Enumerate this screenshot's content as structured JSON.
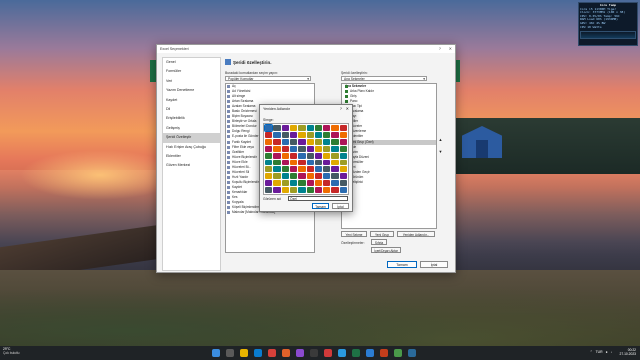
{
  "desktop": {
    "widget": {
      "title": "Core Temp",
      "lines": [
        "Core i5 11300H Tiger",
        "Clock: 3773MHz (100 x 38)",
        "CPU: 0.0%/0%  Temp: 56C",
        "RAM Load 60%  (1934MB)",
        "GPU: 46C  4%  BW",
        "CPU 10 Watts"
      ]
    }
  },
  "excel_options": {
    "title": "Excel Seçenekleri",
    "help": "?",
    "close": "✕",
    "sidebar": [
      {
        "label": "Genel"
      },
      {
        "label": "Formüller"
      },
      {
        "label": "Veri"
      },
      {
        "label": "Yazım Denetleme"
      },
      {
        "label": "Kaydet"
      },
      {
        "label": "Dil"
      },
      {
        "label": "Erişilebilirlik"
      },
      {
        "label": "Gelişmiş"
      },
      {
        "label": "Şeridi Özelleştir"
      },
      {
        "label": "Hızlı Erişim Araç Çubuğu"
      },
      {
        "label": "Eklentiler"
      },
      {
        "label": "Güven Merkezi"
      }
    ],
    "selected_index": 8,
    "header": "Şeridi özelleştirin.",
    "left_label": "Buradaki komutlardan seçim yapın:",
    "left_combo": "Popüler Komutlar",
    "right_label": "Şeridi özelleştirin:",
    "right_combo": "Ana Sekmeler",
    "commands": [
      "Aç",
      "Ad Yöneticisi",
      "Alt simge",
      "Artan Sıralama",
      "Azalan Sıralama",
      "Baskı Önizlemesi",
      "Biçim Boyacısı",
      "Birleştir ve Ortala",
      "Bölmeleri Dondur",
      "Dolgu Rengi",
      "E-posta ile Gönder",
      "Farklı Kaydet",
      "Filtre Ekle veya",
      "Grafikler",
      "Hücre Biçimlendir",
      "Hücre Ekle",
      "Hücreleri Bi...",
      "Hücreleri Sil",
      "Hızlı Yazdır",
      "Koşullu Biçimlendirme",
      "Kaydet",
      "Kenarlıklar",
      "Kes",
      "Kopyala",
      "Köşeli Biçimlendirme",
      "Makrolar [Makroları Görüntüle]"
    ],
    "tree_header": "Ana Sekmeler",
    "tree": [
      "Arka Planı Kaldır",
      "Giriş",
      "Pano",
      "Yazı Tipi",
      "Hizalama",
      "Sayı",
      "Stiller",
      "Hücreler",
      "Düzenleme",
      "Eklentiler",
      "Yeni Grup (Özel)",
      "Ekle",
      "Çizim",
      "Sayfa Düzeni",
      "Formüller",
      "Veri",
      "Gözden Geçir",
      "Görünüm",
      "Geliştirici"
    ],
    "tree_selected_index": 10,
    "new_tab_btn": "Yeni Sekme",
    "new_group_btn": "Yeni Grup",
    "rename_btn": "Yeniden Adlandır...",
    "customizations_label": "Özelleştirmeler:",
    "reset_btn": "Sıfırla",
    "import_export_btn": "İçeri/Dışarı Aktar",
    "add_btn": "»",
    "remove_btn": "«",
    "ok_btn": "Tamam",
    "cancel_btn": "İptal"
  },
  "rename_dialog": {
    "title": "Yeniden Adlandır",
    "help": "?",
    "close": "✕",
    "symbol_label": "Simge:",
    "display_name_label": "Görünen ad:",
    "display_name_value": "Özel",
    "ok_btn": "Tamam",
    "cancel_btn": "İptal"
  },
  "taskbar": {
    "weather_temp": "29°C",
    "weather_desc": "Çok bulutlu",
    "lang": "TUR",
    "time": "00:22",
    "date": "27.10.2023"
  },
  "colors": {
    "accent": "#0067c0",
    "excel_green": "#1e7145"
  }
}
